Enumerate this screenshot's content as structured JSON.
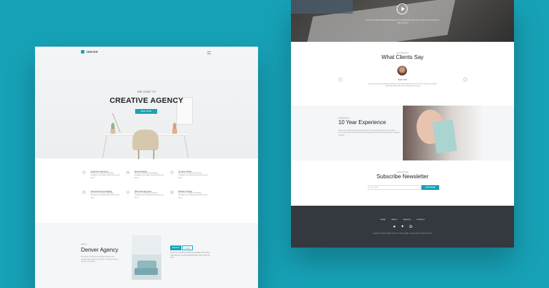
{
  "colors": {
    "accent": "#17a2b8",
    "background": "#17a2b8",
    "footer": "#33393e"
  },
  "left_page": {
    "logo": "DENVER",
    "menu_icon": "hamburger-icon",
    "hero": {
      "kicker": "WELCOME TO",
      "title": "CREATIVE AGENCY",
      "button": "READ MORE"
    },
    "features": [
      {
        "icon": "chat-icon",
        "title": "Customer Services",
        "desc": "We denver a all about simplifying strategies and creating what works for the client."
      },
      {
        "icon": "data-icon",
        "title": "Data Analysis",
        "desc": "We denver a all about simplifying strategies and creating what works for the client."
      },
      {
        "icon": "pen-icon",
        "title": "Content Writer",
        "desc": "We denver a all about simplifying strategies and creating what works for the client."
      },
      {
        "icon": "gear-icon",
        "title": "Financial Accountability",
        "desc": "We denver a all about simplifying strategies and creating what works for the client."
      },
      {
        "icon": "target-icon",
        "title": "Web Development",
        "desc": "We denver a all about simplifying strategies and creating what works for the client."
      },
      {
        "icon": "chart-icon",
        "title": "Modern Design",
        "desc": "We denver a all about simplifying strategies and creating what works for the client."
      }
    ],
    "about": {
      "kicker": "ABOUT",
      "title": "Denver Agency",
      "text": "We denver a all about simplifying strategies and creating what works for the client. Lorem ipsum dolor sit amet consectetur.",
      "tabs": [
        "MISSION",
        "VISION"
      ],
      "tab_text": "We denver a all about simplifying strategies and creating what works for the client goals and lorem ipsum dolor sit amet."
    }
  },
  "right_page": {
    "video_caption": "Denver a all about simplifying strategies and creating what works for the client. It's our mission to help you grow.",
    "testimonials": {
      "kicker": "TESTIMONIALS",
      "title": "What Clients Say",
      "name": "Jaylen Vess",
      "quote": "Denver a all about simplifying strategies and creating what works for the client. We help our clients reach their goals with modern solutions every day."
    },
    "experience": {
      "kicker": "EXPERIENCE",
      "title": "10 Year Experience",
      "text": "We denver a all about simplifying strategies and creating what works for the client. Lorem ipsum dolor sit amet consectetur adipiscing elit sed do eiusmod tempor incididunt ut labore."
    },
    "newsletter": {
      "kicker": "NEWSLETTER",
      "title": "Subscribe Newsletter",
      "placeholder": "Your email",
      "button": "SUBSCRIBE"
    },
    "footer": {
      "nav": [
        "HOME",
        "ABOUT",
        "SERVICE",
        "CONTACT"
      ],
      "social": [
        "facebook-icon",
        "twitter-icon",
        "instagram-icon"
      ],
      "copyright": "Copyright © 2021 All rights reserved | This template is made with ♥ by Denver Theme"
    }
  }
}
